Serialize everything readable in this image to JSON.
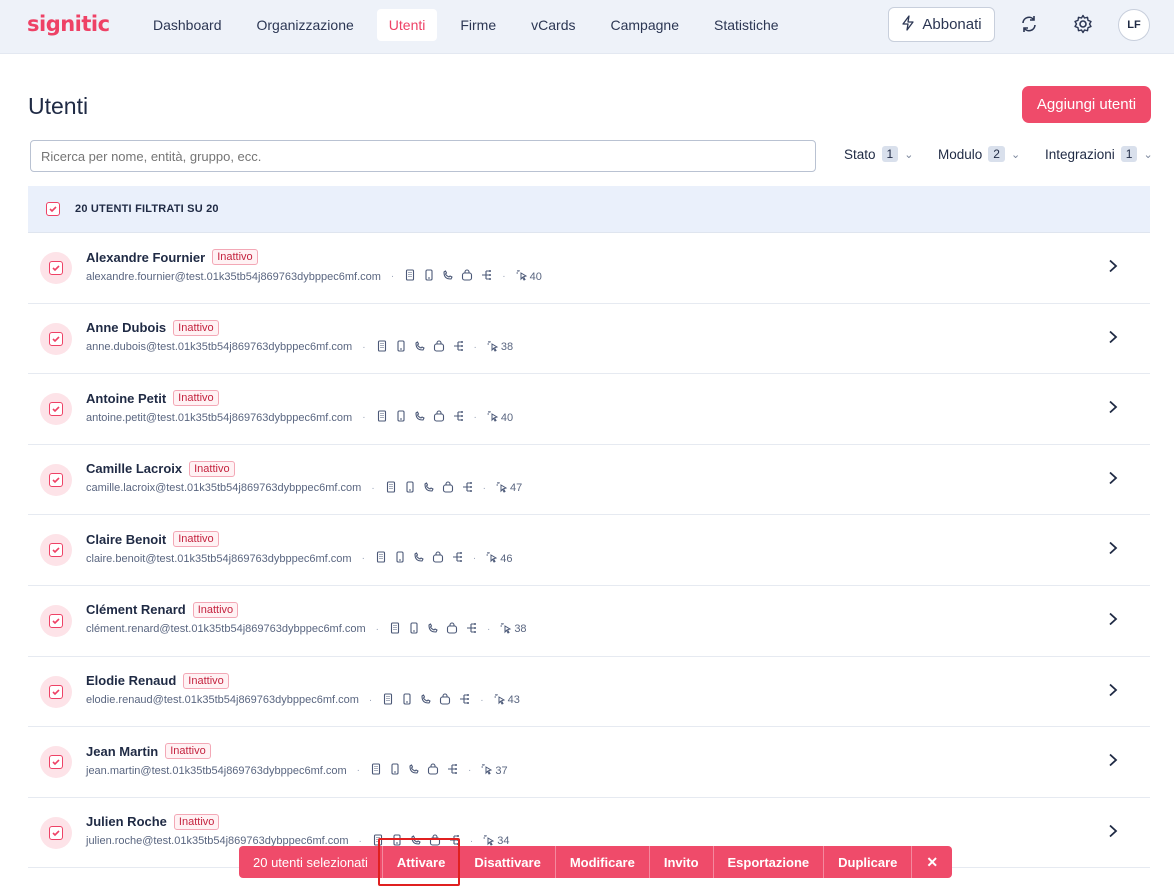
{
  "app": {
    "logo": "signitic"
  },
  "nav": {
    "items": [
      {
        "label": "Dashboard"
      },
      {
        "label": "Organizzazione"
      },
      {
        "label": "Utenti"
      },
      {
        "label": "Firme"
      },
      {
        "label": "vCards"
      },
      {
        "label": "Campagne"
      },
      {
        "label": "Statistiche"
      }
    ],
    "active": "Utenti",
    "subscribe_label": "Abbonati",
    "avatar_initials": "LF"
  },
  "page": {
    "title": "Utenti",
    "add_button": "Aggiungi utenti",
    "search_placeholder": "Ricerca per nome, entità, gruppo, ecc."
  },
  "filters": [
    {
      "label": "Stato",
      "count": "1"
    },
    {
      "label": "Modulo",
      "count": "2"
    },
    {
      "label": "Integrazioni",
      "count": "1"
    }
  ],
  "list": {
    "header_label": "20 UTENTI FILTRATI SU 20",
    "users": [
      {
        "name": "Alexandre Fournier",
        "status": "Inattivo",
        "email": "alexandre.fournier@test.01k35tb54j869763dybppec6mf.com",
        "clicks": "40"
      },
      {
        "name": "Anne Dubois",
        "status": "Inattivo",
        "email": "anne.dubois@test.01k35tb54j869763dybppec6mf.com",
        "clicks": "38"
      },
      {
        "name": "Antoine Petit",
        "status": "Inattivo",
        "email": "antoine.petit@test.01k35tb54j869763dybppec6mf.com",
        "clicks": "40"
      },
      {
        "name": "Camille Lacroix",
        "status": "Inattivo",
        "email": "camille.lacroix@test.01k35tb54j869763dybppec6mf.com",
        "clicks": "47"
      },
      {
        "name": "Claire Benoit",
        "status": "Inattivo",
        "email": "claire.benoit@test.01k35tb54j869763dybppec6mf.com",
        "clicks": "46"
      },
      {
        "name": "Clément Renard",
        "status": "Inattivo",
        "email": "clément.renard@test.01k35tb54j869763dybppec6mf.com",
        "clicks": "38"
      },
      {
        "name": "Elodie Renaud",
        "status": "Inattivo",
        "email": "elodie.renaud@test.01k35tb54j869763dybppec6mf.com",
        "clicks": "43"
      },
      {
        "name": "Jean Martin",
        "status": "Inattivo",
        "email": "jean.martin@test.01k35tb54j869763dybppec6mf.com",
        "clicks": "37"
      },
      {
        "name": "Julien Roche",
        "status": "Inattivo",
        "email": "julien.roche@test.01k35tb54j869763dybppec6mf.com",
        "clicks": "34"
      }
    ]
  },
  "bulk_bar": {
    "selected_label": "20 utenti selezionati",
    "actions": [
      {
        "label": "Attivare"
      },
      {
        "label": "Disattivare"
      },
      {
        "label": "Modificare"
      },
      {
        "label": "Invito"
      },
      {
        "label": "Esportazione"
      },
      {
        "label": "Duplicare"
      }
    ],
    "close_glyph": "✕"
  },
  "colors": {
    "brand": "#ee4266",
    "button": "#ef4b6a",
    "header_bg": "#eef2f9",
    "list_header_bg": "#eaf0fb"
  },
  "icons": [
    "bolt-icon",
    "sync-icon",
    "gear-icon",
    "building-icon",
    "mobile-icon",
    "phone-icon",
    "bag-icon",
    "org-chart-icon",
    "click-icon",
    "chevron-right-icon",
    "close-icon"
  ]
}
